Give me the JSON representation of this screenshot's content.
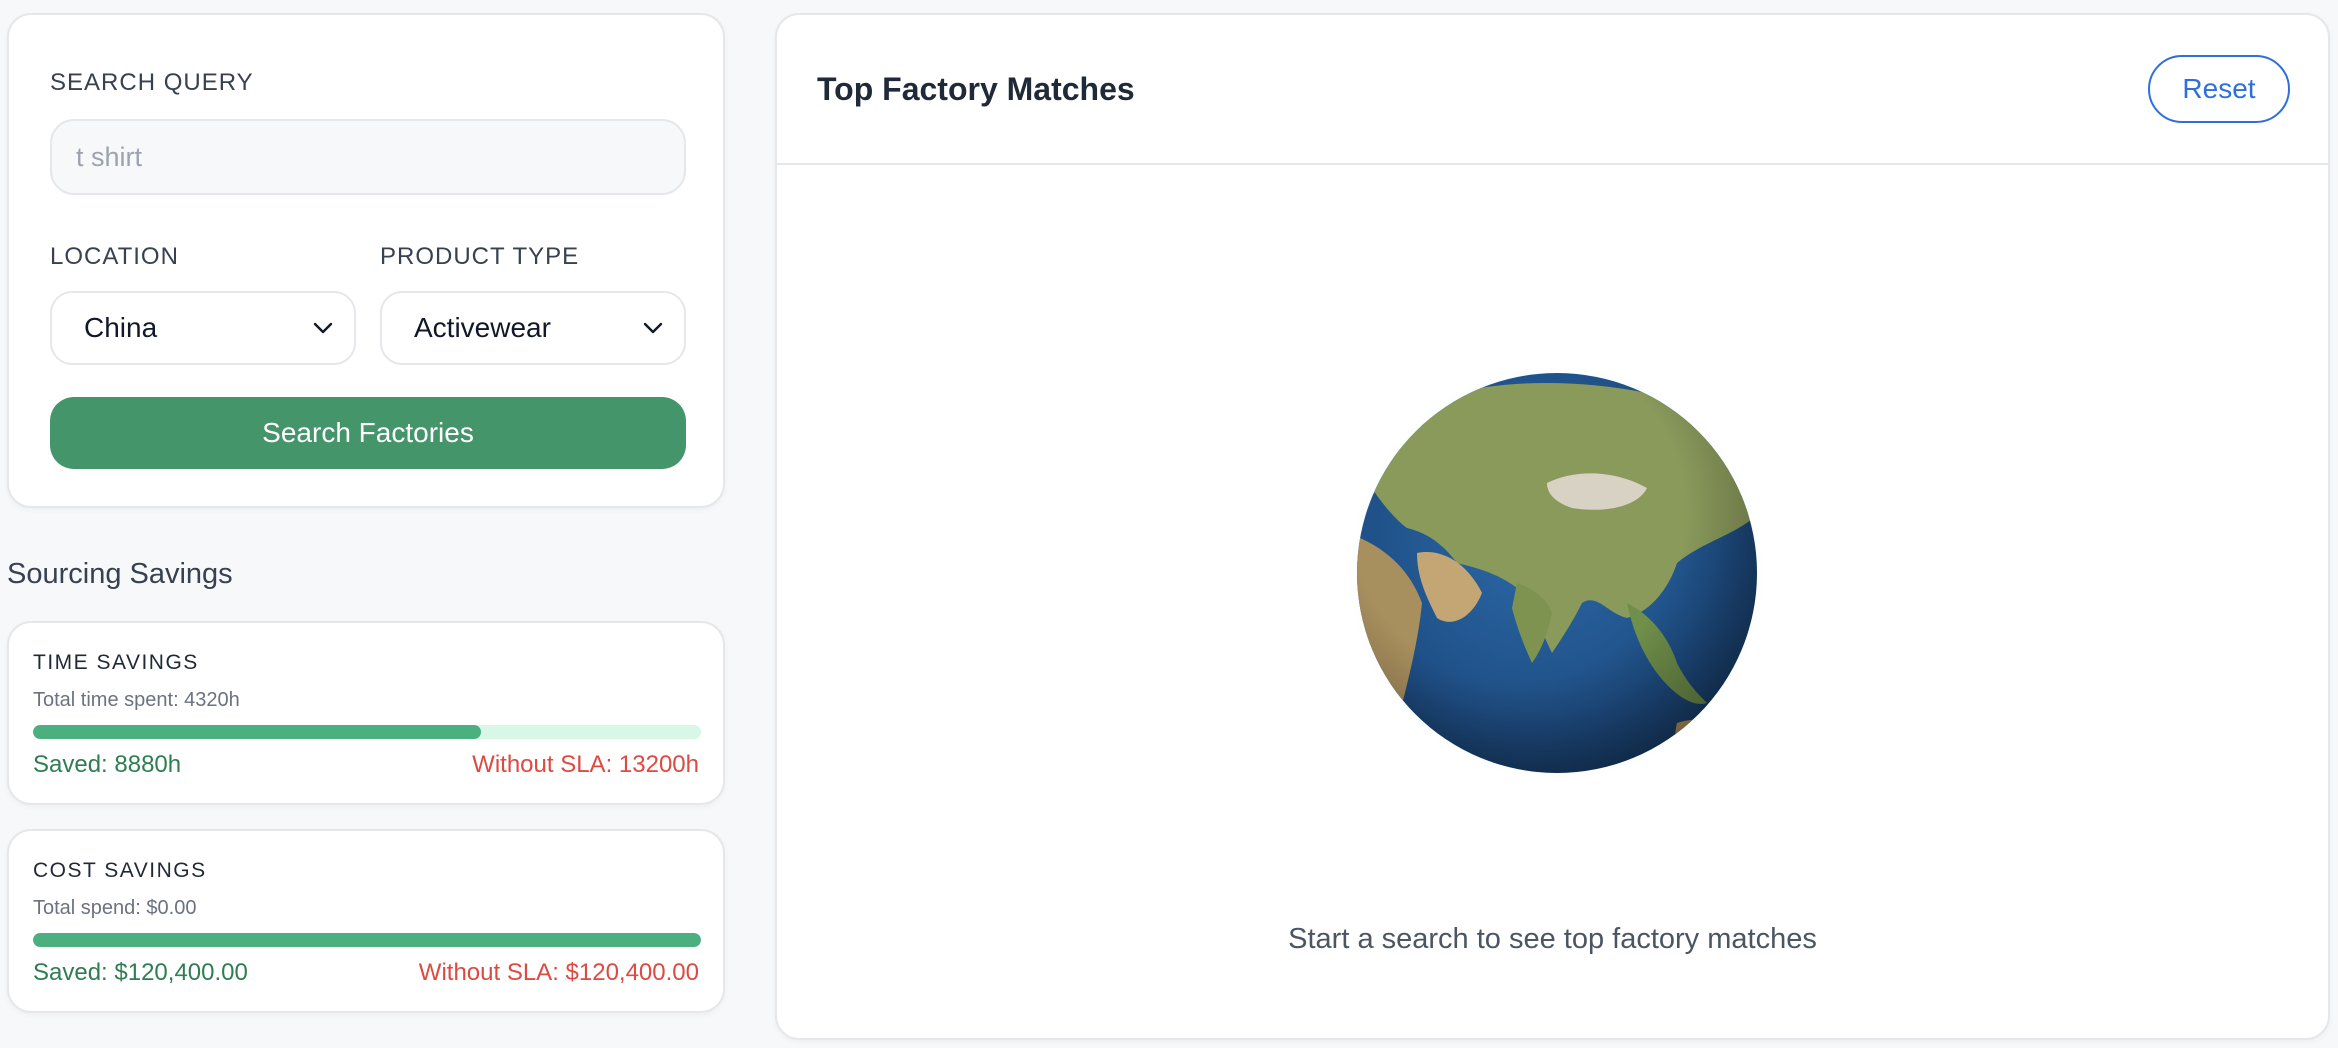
{
  "search": {
    "query_label": "SEARCH QUERY",
    "query_placeholder": "t shirt",
    "query_value": "",
    "location_label": "LOCATION",
    "location_value": "China",
    "product_type_label": "PRODUCT TYPE",
    "product_type_value": "Activewear",
    "submit_label": "Search Factories"
  },
  "savings": {
    "section_title": "Sourcing Savings",
    "time": {
      "title": "TIME SAVINGS",
      "subtitle": "Total time spent: 4320h",
      "progress": 0.67,
      "saved": "Saved: 8880h",
      "without_sla": "Without SLA: 13200h"
    },
    "cost": {
      "title": "COST SAVINGS",
      "subtitle": "Total spend: $0.00",
      "progress": 1.0,
      "saved": "Saved: $120,400.00",
      "without_sla": "Without SLA: $120,400.00"
    }
  },
  "results": {
    "title": "Top Factory Matches",
    "reset_label": "Reset",
    "empty_message": "Start a search to see top factory matches"
  },
  "colors": {
    "accent_green": "#45956b",
    "saved_green": "#2f7d52",
    "warning_red": "#dc4a42",
    "link_blue": "#2f6fdc"
  },
  "icons": {
    "location_select": "chevron-down-icon",
    "product_select": "chevron-down-icon",
    "globe": "globe-icon"
  }
}
